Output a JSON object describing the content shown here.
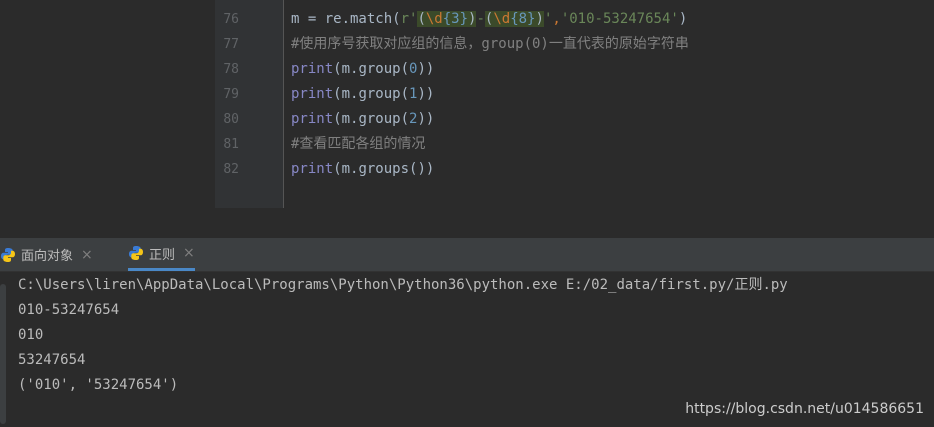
{
  "editor": {
    "line_numbers": [
      "76",
      "77",
      "78",
      "79",
      "80",
      "81",
      "82"
    ],
    "lines": {
      "l76": {
        "prefix": "m = re.match(",
        "rprefix": "r'",
        "g1open": "(",
        "g1esc": "\\d",
        "g1q": "{3}",
        "g1close": ")",
        "dash": "-",
        "g2open": "(",
        "g2esc": "\\d",
        "g2q": "{8}",
        "g2close": ")",
        "rquote": "'",
        "comma": ",",
        "arg": "'010-53247654'",
        "suffix": ")"
      },
      "l77": "#使用序号获取对应组的信息，group(0)一直代表的原始字符串",
      "l78": {
        "fn": "print",
        "args": "(m.group(",
        "num": "0",
        "end": "))"
      },
      "l79": {
        "fn": "print",
        "args": "(m.group(",
        "num": "1",
        "end": "))"
      },
      "l80": {
        "fn": "print",
        "args": "(m.group(",
        "num": "2",
        "end": "))"
      },
      "l81": "#查看匹配各组的情况",
      "l82": {
        "fn": "print",
        "args": "(m.groups())"
      }
    }
  },
  "tabs": [
    {
      "label": "面向对象",
      "close": "×"
    },
    {
      "label": "正则",
      "close": "×"
    }
  ],
  "console": {
    "lines": [
      "C:\\Users\\liren\\AppData\\Local\\Programs\\Python\\Python36\\python.exe E:/02_data/first.py/正则.py",
      "010-53247654",
      "010",
      "53247654",
      "('010', '53247654')"
    ]
  },
  "watermark": "https://blog.csdn.net/u014586651",
  "colors": {
    "editor_bg": "#2b2b2b",
    "gutter_bg": "#313335",
    "tabbar_bg": "#3c3f41",
    "active_tab_underline": "#4a88c7"
  }
}
